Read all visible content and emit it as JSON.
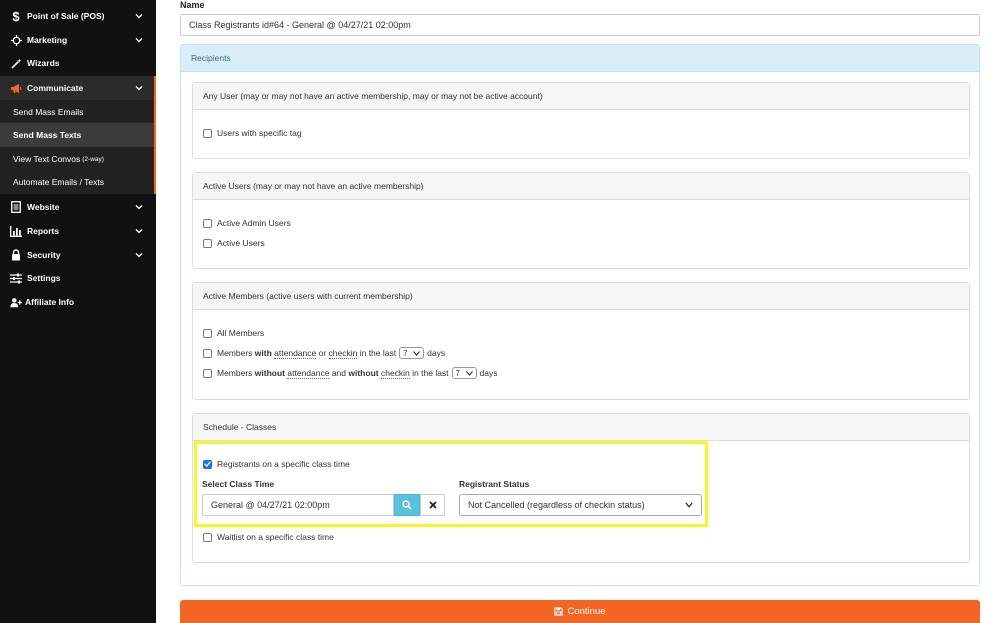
{
  "sidebar": {
    "items": [
      {
        "label": "Point of Sale (POS)",
        "icon": "dollar-icon"
      },
      {
        "label": "Marketing",
        "icon": "crosshair-icon"
      },
      {
        "label": "Wizards",
        "icon": "wand-icon"
      },
      {
        "label": "Communicate",
        "icon": "megaphone-icon"
      },
      {
        "label": "Website",
        "icon": "document-icon"
      },
      {
        "label": "Reports",
        "icon": "bar-chart-icon"
      },
      {
        "label": "Security",
        "icon": "lock-icon"
      },
      {
        "label": "Settings",
        "icon": "sliders-icon"
      },
      {
        "label": "Affiliate Info",
        "icon": "user-plus-icon"
      }
    ],
    "communicate_sub": [
      {
        "label": "Send Mass Emails"
      },
      {
        "label": "Send Mass Texts"
      },
      {
        "label": "View Text Convos",
        "small": "(2-way)"
      },
      {
        "label": "Automate Emails / Texts"
      }
    ],
    "accent_color": "#f26522"
  },
  "form": {
    "name_label": "Name",
    "name_value": "Class Registrants id#64 - General @ 04/27/21 02:00pm",
    "recipients_title": "Recipients",
    "any_user": {
      "title": "Any User (may or may not have an active membership, may or may not be active account)",
      "options": [
        "Users with specific tag"
      ]
    },
    "active_users": {
      "title": "Active Users (may or may not have an active membership)",
      "options": [
        "Active Admin Users",
        "Active Users"
      ]
    },
    "active_members": {
      "title": "Active Members (active users with current membership)",
      "all_members": "All Members",
      "with_row": {
        "p1": "Members ",
        "p2": "with",
        "p3": " ",
        "p4": "attendance",
        "p5": " or ",
        "p6": "checkin",
        "p7": " in the last",
        "days_value": "7",
        "days_label": "days"
      },
      "without_row": {
        "p1": "Members ",
        "p2": "without",
        "p3": " ",
        "p4": "attendance",
        "p5": " and ",
        "p6": "without",
        "p7": " ",
        "p8": "checkin",
        "p9": " in the last",
        "days_value": "7",
        "days_label": "days"
      }
    },
    "schedule": {
      "title": "Schedule - Classes",
      "registrants_label": "Registrants on a specific class time",
      "registrants_checked": true,
      "select_class_time_label": "Select Class Time",
      "class_time_value": "General @ 04/27/21 02:00pm",
      "registrant_status_label": "Registrant Status",
      "registrant_status_value": "Not Cancelled (regardless of checkin status)",
      "waitlist_label": "Waitlist on a specific class time"
    },
    "continue_label": "Continue",
    "highlight_color": "#f7f727",
    "button_color": "#f26522"
  }
}
